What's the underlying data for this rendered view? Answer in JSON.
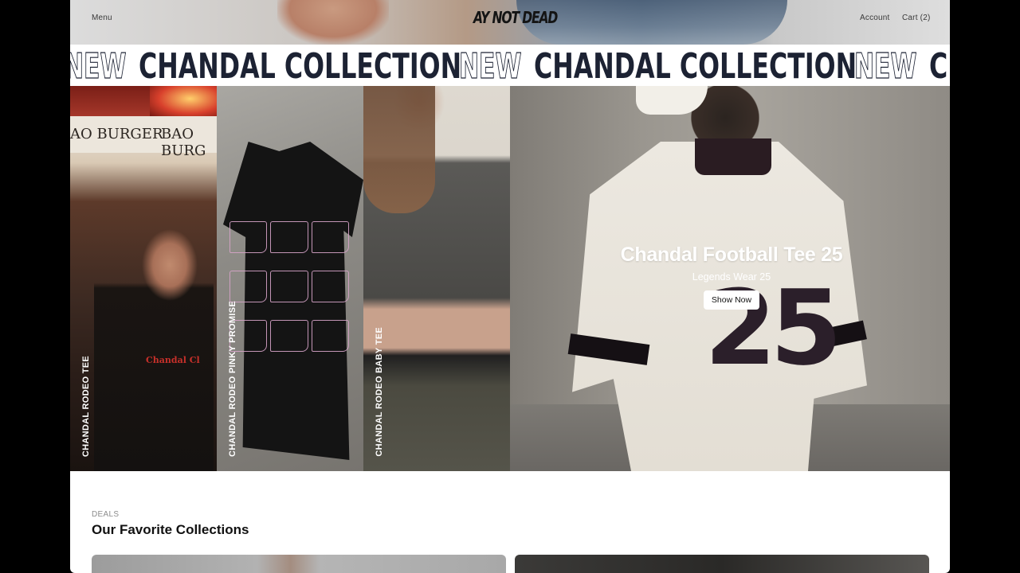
{
  "header": {
    "menu_label": "Menu",
    "logo_text": "AY NOT DEAD",
    "account_label": "Account",
    "cart_label": "Cart (2)"
  },
  "marquee": {
    "new_word": "NEW",
    "collection_text": "CHANDAL COLLECTION"
  },
  "hero": {
    "panels": [
      {
        "label": "CHANDAL RODEO TEE"
      },
      {
        "label": "CHANDAL RODEO PINKY PROMISE"
      },
      {
        "label": "CHANDAL RODEO BABY TEE"
      }
    ],
    "feature": {
      "title": "Chandal Football Tee 25",
      "subtitle": "Legends Wear 25",
      "button_label": "Show Now",
      "jersey_number": "25"
    },
    "sign_text_1": "AO BURGER",
    "sign_text_2": "BAO BURG",
    "tee_print": "Chandal Cl"
  },
  "collections": {
    "eyebrow": "DEALS",
    "title": "Our Favorite Collections"
  },
  "colors": {
    "marquee_ink": "#1c2233",
    "page_bg": "#ffffff",
    "frame_bg": "#000000"
  }
}
